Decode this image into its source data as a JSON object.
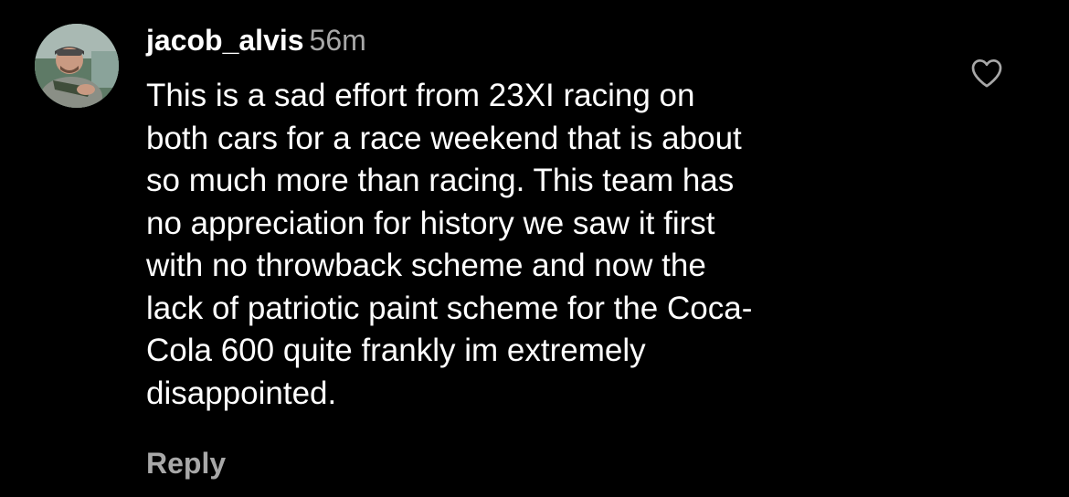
{
  "comment": {
    "username": "jacob_alvis",
    "time_ago": "56m",
    "lines": [
      "This is a sad effort from 23XI racing on",
      "both cars for a race weekend that is about",
      "so much more than racing. This team has",
      "no appreciation for history we saw it first",
      "with no throwback scheme and now the",
      "lack of patriotic paint scheme for the Coca-",
      "Cola 600 quite frankly im extremely",
      "disappointed."
    ],
    "reply_label": "Reply",
    "like_icon": "heart-outline-icon"
  },
  "colors": {
    "background": "#000000",
    "text_primary": "#ffffff",
    "text_secondary": "#a8a8a8"
  }
}
